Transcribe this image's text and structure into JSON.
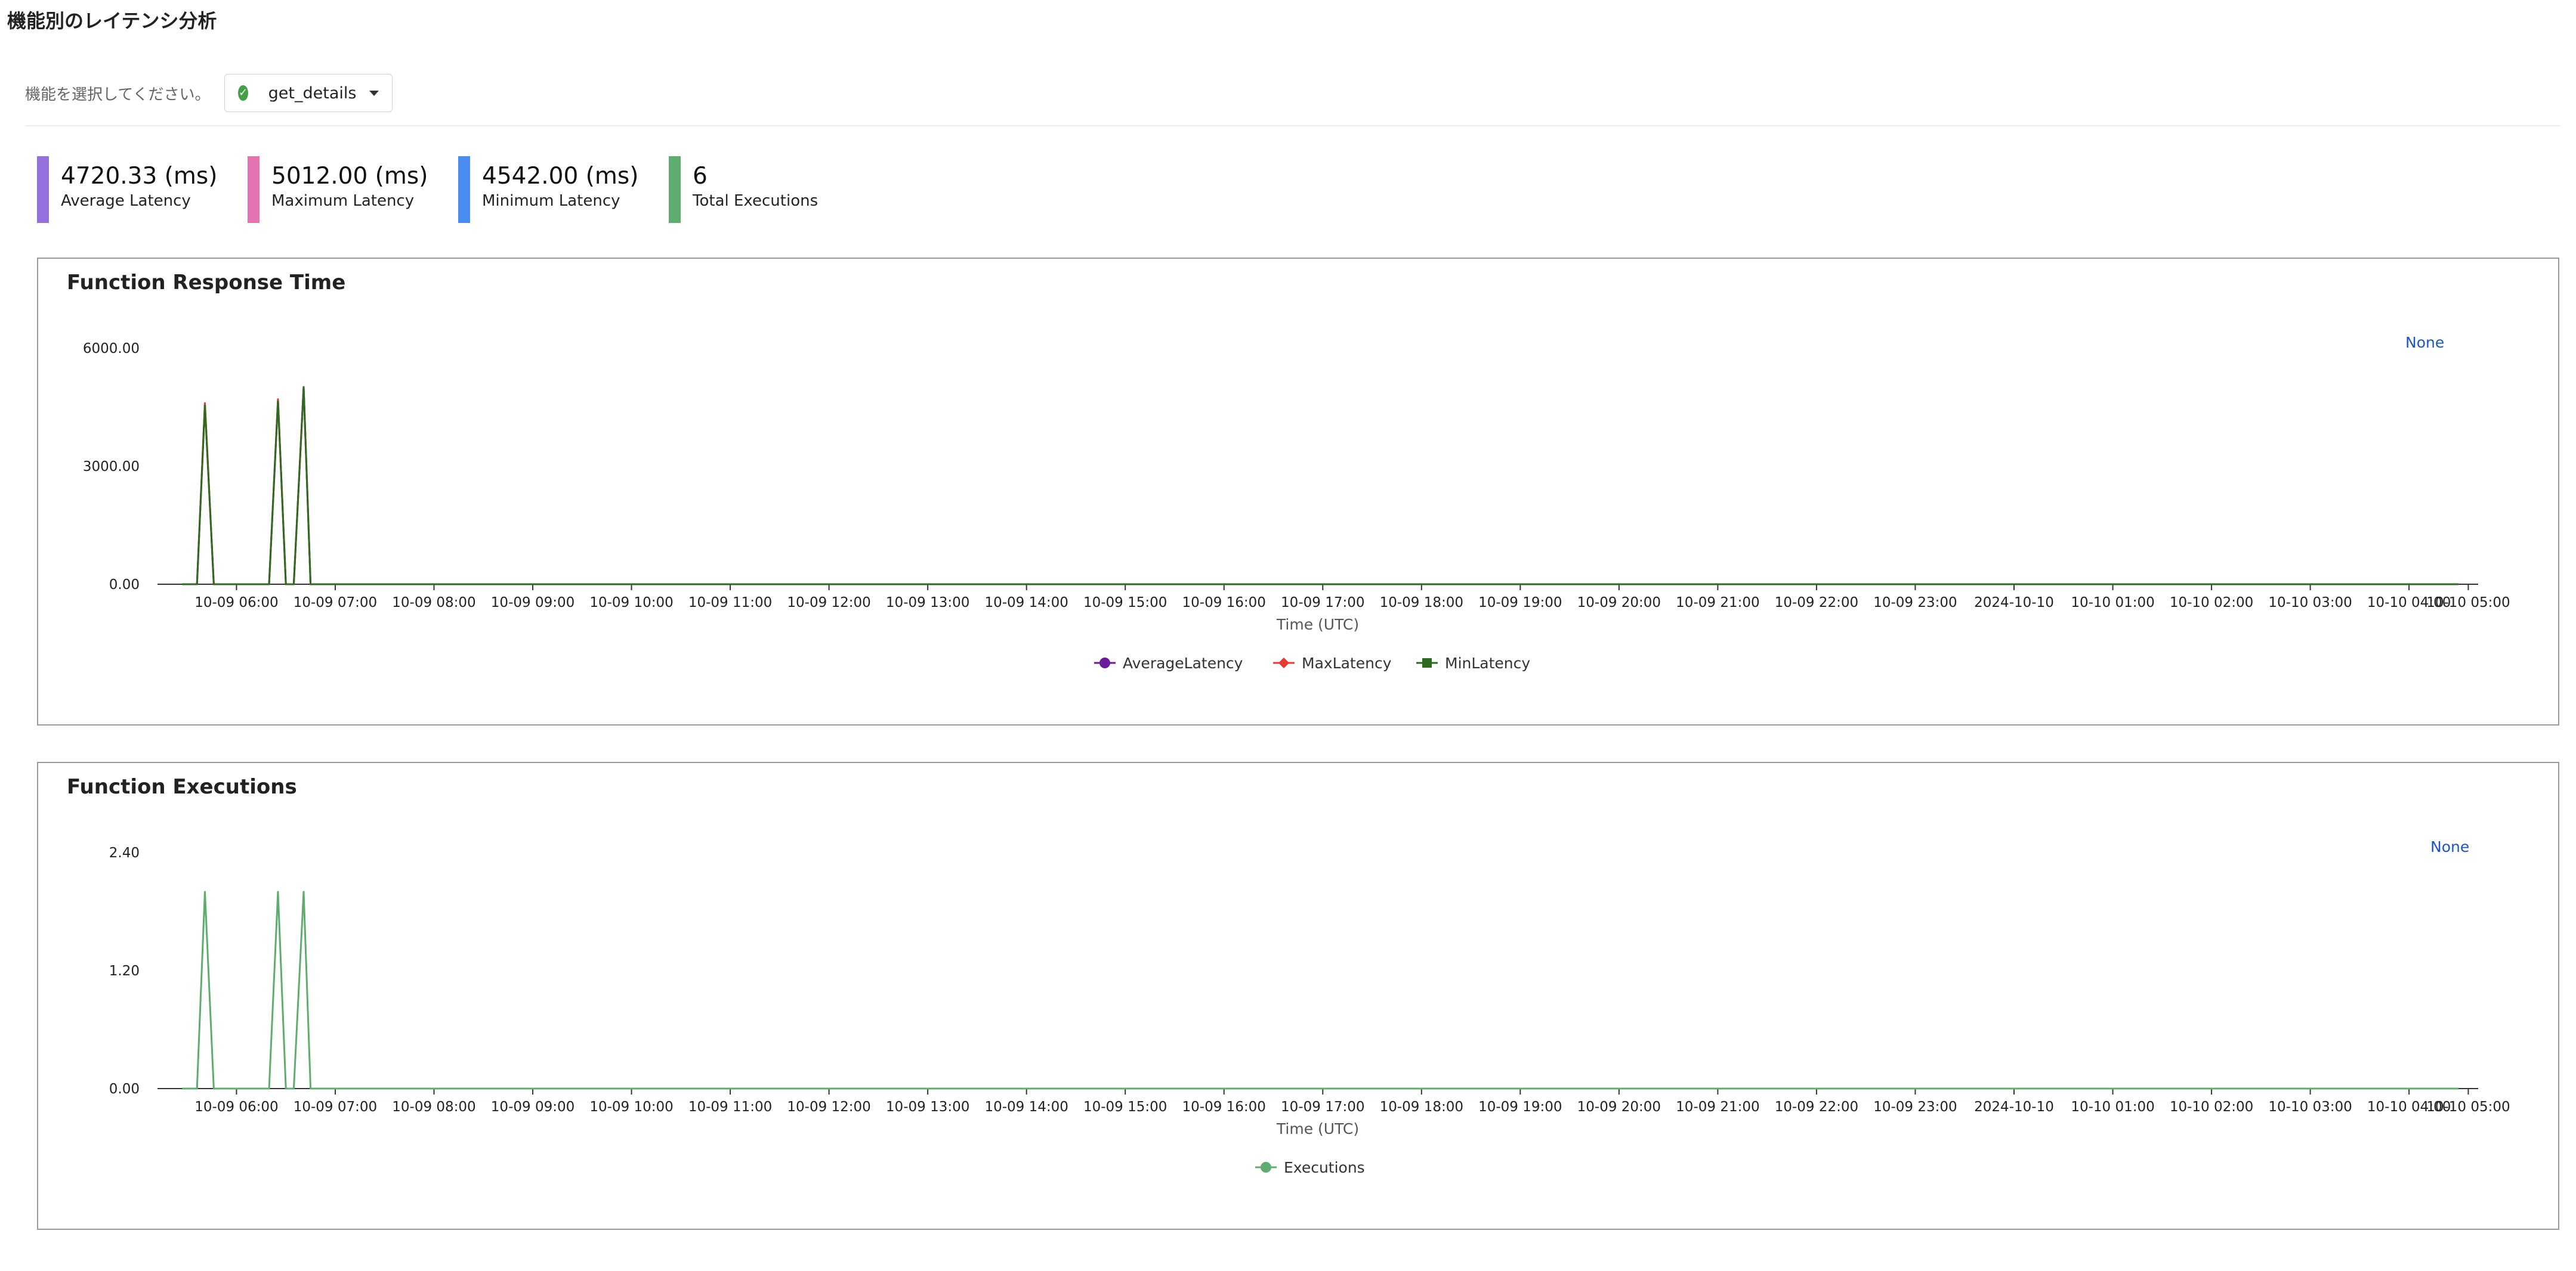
{
  "page": {
    "title": "機能別のレイテンシ分析",
    "selector_label": "機能を選択してください。",
    "selected_function": "get_details"
  },
  "stats": [
    {
      "value": "4720.33 (ms)",
      "label": "Average Latency",
      "color": "#9370db"
    },
    {
      "value": "5012.00 (ms)",
      "label": "Maximum Latency",
      "color": "#e573b1"
    },
    {
      "value": "4542.00 (ms)",
      "label": "Minimum Latency",
      "color": "#4a8cf0"
    },
    {
      "value": "6",
      "label": "Total Executions",
      "color": "#5fad6e"
    }
  ],
  "panels": {
    "response": {
      "title": "Function Response Time",
      "link": "None"
    },
    "executions": {
      "title": "Function Executions",
      "link": "None"
    }
  },
  "chart_data": [
    {
      "type": "line",
      "title": "Function Response Time",
      "xlabel": "Time (UTC)",
      "ylabel": "",
      "x_range": [
        5.7,
        29.2
      ],
      "ylim": [
        0,
        6000
      ],
      "yticks": [
        "0.00",
        "3000.00",
        "6000.00"
      ],
      "ytick_values": [
        0,
        3000,
        6000
      ],
      "xticks": [
        {
          "x": 6.5,
          "label": "10-09 06:00"
        },
        {
          "x": 7.5,
          "label": "10-09 07:00"
        },
        {
          "x": 8.5,
          "label": "10-09 08:00"
        },
        {
          "x": 9.5,
          "label": "10-09 09:00"
        },
        {
          "x": 10.5,
          "label": "10-09 10:00"
        },
        {
          "x": 11.5,
          "label": "10-09 11:00"
        },
        {
          "x": 12.5,
          "label": "10-09 12:00"
        },
        {
          "x": 13.5,
          "label": "10-09 13:00"
        },
        {
          "x": 14.5,
          "label": "10-09 14:00"
        },
        {
          "x": 15.5,
          "label": "10-09 15:00"
        },
        {
          "x": 16.5,
          "label": "10-09 16:00"
        },
        {
          "x": 17.5,
          "label": "10-09 17:00"
        },
        {
          "x": 18.5,
          "label": "10-09 18:00"
        },
        {
          "x": 19.5,
          "label": "10-09 19:00"
        },
        {
          "x": 20.5,
          "label": "10-09 20:00"
        },
        {
          "x": 21.5,
          "label": "10-09 21:00"
        },
        {
          "x": 22.5,
          "label": "10-09 22:00"
        },
        {
          "x": 23.5,
          "label": "10-09 23:00"
        },
        {
          "x": 24.5,
          "label": "2024-10-10"
        },
        {
          "x": 25.5,
          "label": "10-10 01:00"
        },
        {
          "x": 26.5,
          "label": "10-10 02:00"
        },
        {
          "x": 27.5,
          "label": "10-10 03:00"
        },
        {
          "x": 28.5,
          "label": "10-10 04:00"
        },
        {
          "x": 29.1,
          "label": "10-10 05:00"
        }
      ],
      "x": [
        5.95,
        6.1,
        6.18,
        6.27,
        6.35,
        6.83,
        6.92,
        7.0,
        7.08,
        7.18,
        7.25,
        7.35,
        29.0
      ],
      "series": [
        {
          "name": "AverageLatency",
          "color": "#6a1b9a",
          "marker": "circle",
          "values": [
            0,
            0,
            4600,
            0,
            0,
            0,
            4700,
            0,
            0,
            5012,
            0,
            0,
            0
          ]
        },
        {
          "name": "MaxLatency",
          "color": "#e53935",
          "marker": "diamond",
          "values": [
            0,
            0,
            4600,
            0,
            0,
            0,
            4700,
            0,
            0,
            5012,
            0,
            0,
            0
          ]
        },
        {
          "name": "MinLatency",
          "color": "#2e6b1f",
          "marker": "square",
          "values": [
            0,
            0,
            4542,
            0,
            0,
            0,
            4650,
            0,
            0,
            5012,
            0,
            0,
            0
          ]
        }
      ]
    },
    {
      "type": "line",
      "title": "Function Executions",
      "xlabel": "Time (UTC)",
      "ylabel": "",
      "x_range": [
        5.7,
        29.2
      ],
      "ylim": [
        0,
        2.4
      ],
      "yticks": [
        "0.00",
        "1.20",
        "2.40"
      ],
      "ytick_values": [
        0,
        1.2,
        2.4
      ],
      "xticks": [
        {
          "x": 6.5,
          "label": "10-09 06:00"
        },
        {
          "x": 7.5,
          "label": "10-09 07:00"
        },
        {
          "x": 8.5,
          "label": "10-09 08:00"
        },
        {
          "x": 9.5,
          "label": "10-09 09:00"
        },
        {
          "x": 10.5,
          "label": "10-09 10:00"
        },
        {
          "x": 11.5,
          "label": "10-09 11:00"
        },
        {
          "x": 12.5,
          "label": "10-09 12:00"
        },
        {
          "x": 13.5,
          "label": "10-09 13:00"
        },
        {
          "x": 14.5,
          "label": "10-09 14:00"
        },
        {
          "x": 15.5,
          "label": "10-09 15:00"
        },
        {
          "x": 16.5,
          "label": "10-09 16:00"
        },
        {
          "x": 17.5,
          "label": "10-09 17:00"
        },
        {
          "x": 18.5,
          "label": "10-09 18:00"
        },
        {
          "x": 19.5,
          "label": "10-09 19:00"
        },
        {
          "x": 20.5,
          "label": "10-09 20:00"
        },
        {
          "x": 21.5,
          "label": "10-09 21:00"
        },
        {
          "x": 22.5,
          "label": "10-09 22:00"
        },
        {
          "x": 23.5,
          "label": "10-09 23:00"
        },
        {
          "x": 24.5,
          "label": "2024-10-10"
        },
        {
          "x": 25.5,
          "label": "10-10 01:00"
        },
        {
          "x": 26.5,
          "label": "10-10 02:00"
        },
        {
          "x": 27.5,
          "label": "10-10 03:00"
        },
        {
          "x": 28.5,
          "label": "10-10 04:00"
        },
        {
          "x": 29.1,
          "label": "10-10 05:00"
        }
      ],
      "x": [
        5.95,
        6.1,
        6.18,
        6.27,
        6.35,
        6.83,
        6.92,
        7.0,
        7.08,
        7.18,
        7.25,
        7.35,
        29.0
      ],
      "series": [
        {
          "name": "Executions",
          "color": "#5fad6e",
          "marker": "circle",
          "values": [
            0,
            0,
            2,
            0,
            0,
            0,
            2,
            0,
            0,
            2,
            0,
            0,
            0
          ]
        }
      ]
    }
  ]
}
